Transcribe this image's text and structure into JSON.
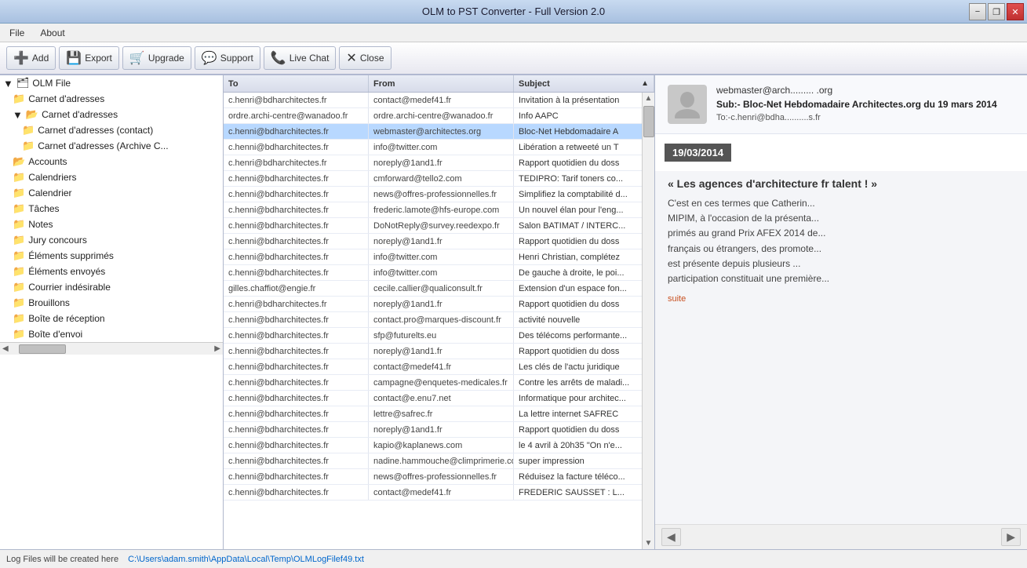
{
  "window": {
    "title": "OLM to PST Converter - Full Version 2.0",
    "controls": {
      "minimize": "−",
      "restore": "❐",
      "close": "✕"
    }
  },
  "menu": {
    "items": [
      "File",
      "About"
    ]
  },
  "toolbar": {
    "buttons": [
      {
        "id": "add",
        "icon": "➕",
        "label": "Add"
      },
      {
        "id": "export",
        "icon": "💾",
        "label": "Export"
      },
      {
        "id": "upgrade",
        "icon": "🛒",
        "label": "Upgrade"
      },
      {
        "id": "support",
        "icon": "💬",
        "label": "Support"
      },
      {
        "id": "livechat",
        "icon": "📞",
        "label": "Live Chat"
      },
      {
        "id": "close",
        "icon": "✕",
        "label": "Close"
      }
    ]
  },
  "tree": {
    "items": [
      {
        "id": "olm-root",
        "indent": 0,
        "icon": "📁",
        "label": "OLM File",
        "expanded": true
      },
      {
        "id": "carnet1",
        "indent": 1,
        "icon": "📂",
        "label": "Carnet d'adresses"
      },
      {
        "id": "carnet2",
        "indent": 1,
        "icon": "📂",
        "label": "Carnet d'adresses",
        "expanded": true
      },
      {
        "id": "carnet-contact",
        "indent": 2,
        "icon": "📂",
        "label": "Carnet d'adresses  (contact)"
      },
      {
        "id": "carnet-archive",
        "indent": 2,
        "icon": "📂",
        "label": "Carnet d'adresses  (Archive C..."
      },
      {
        "id": "accounts",
        "indent": 1,
        "icon": "📂",
        "label": "Accounts"
      },
      {
        "id": "calendriers",
        "indent": 1,
        "icon": "📁",
        "label": "Calendriers"
      },
      {
        "id": "calendrier",
        "indent": 1,
        "icon": "📁",
        "label": "Calendrier"
      },
      {
        "id": "taches",
        "indent": 1,
        "icon": "📁",
        "label": "Tâches"
      },
      {
        "id": "notes",
        "indent": 1,
        "icon": "📁",
        "label": "Notes"
      },
      {
        "id": "jury",
        "indent": 1,
        "icon": "📁",
        "label": "Jury concours"
      },
      {
        "id": "elements-sup",
        "indent": 1,
        "icon": "📁",
        "label": "Éléments supprimés"
      },
      {
        "id": "elements-env",
        "indent": 1,
        "icon": "📁",
        "label": "Éléments envoyés"
      },
      {
        "id": "courrier",
        "indent": 1,
        "icon": "📁",
        "label": "Courrier indésirable"
      },
      {
        "id": "brouillons",
        "indent": 1,
        "icon": "📁",
        "label": "Brouillons"
      },
      {
        "id": "boite-reception",
        "indent": 1,
        "icon": "📁",
        "label": "Boîte de réception"
      },
      {
        "id": "boite-envoi",
        "indent": 1,
        "icon": "📁",
        "label": "Boîte d'envoi"
      }
    ]
  },
  "email_list": {
    "headers": {
      "to": "To",
      "from": "From",
      "subject": "Subject"
    },
    "rows": [
      {
        "to": "c.henri@bdharchitectes.fr",
        "from": "contact@medef41.fr",
        "subject": "Invitation à la présentation"
      },
      {
        "to": "ordre.archi-centre@wanadoo.fr",
        "from": "ordre.archi-centre@wanadoo.fr",
        "subject": "Info AAPC"
      },
      {
        "to": "c.henni@bdharchitectes.fr",
        "from": "webmaster@architectes.org",
        "subject": "Bloc-Net Hebdomadaire A"
      },
      {
        "to": "c.henni@bdharchitectes.fr",
        "from": "info@twitter.com",
        "subject": "Libération a retweeté un T"
      },
      {
        "to": "c.henri@bdharchitectes.fr",
        "from": "noreply@1and1.fr",
        "subject": "Rapport quotidien du doss"
      },
      {
        "to": "c.henni@bdharchitectes.fr",
        "from": "cmforward@tello2.com",
        "subject": "TEDIPRO: Tarif toners co..."
      },
      {
        "to": "c.henni@bdharchitectes.fr",
        "from": "news@offres-professionnelles.fr",
        "subject": "Simplifiez la comptabilité d..."
      },
      {
        "to": "c.henni@bdharchitectes.fr",
        "from": "frederic.lamote@hfs-europe.com",
        "subject": "Un nouvel élan pour l'eng..."
      },
      {
        "to": "c.henni@bdharchitectes.fr",
        "from": "DoNotReply@survey.reedexpo.fr",
        "subject": "Salon BATIMAT / INTERC..."
      },
      {
        "to": "c.henni@bdharchitectes.fr",
        "from": "noreply@1and1.fr",
        "subject": "Rapport quotidien du doss"
      },
      {
        "to": "c.henni@bdharchitectes.fr",
        "from": "info@twitter.com",
        "subject": "Henri Christian, complétez"
      },
      {
        "to": "c.henni@bdharchitectes.fr",
        "from": "info@twitter.com",
        "subject": "De gauche à droite, le poi..."
      },
      {
        "to": "gilles.chaffiot@engie.fr",
        "from": "cecile.callier@qualiconsult.fr",
        "subject": "Extension d'un espace fon..."
      },
      {
        "to": "c.henri@bdharchitectes.fr",
        "from": "noreply@1and1.fr",
        "subject": "Rapport quotidien du doss"
      },
      {
        "to": "c.henni@bdharchitectes.fr",
        "from": "contact.pro@marques-discount.fr",
        "subject": "activité nouvelle"
      },
      {
        "to": "c.henni@bdharchitectes.fr",
        "from": "sfp@futurelts.eu",
        "subject": "Des télécoms performante..."
      },
      {
        "to": "c.henni@bdharchitectes.fr",
        "from": "noreply@1and1.fr",
        "subject": "Rapport quotidien du doss"
      },
      {
        "to": "c.henni@bdharchitectes.fr",
        "from": "contact@medef41.fr",
        "subject": "Les clés de l'actu juridique"
      },
      {
        "to": "c.henni@bdharchitectes.fr",
        "from": "campagne@enquetes-medicales.fr",
        "subject": "Contre les arrêts de maladi..."
      },
      {
        "to": "c.henni@bdharchitectes.fr",
        "from": "contact@e.enu7.net",
        "subject": "Informatique pour architec..."
      },
      {
        "to": "c.henni@bdharchitectes.fr",
        "from": "lettre@safrec.fr",
        "subject": "La lettre internet SAFREC"
      },
      {
        "to": "c.henni@bdharchitectes.fr",
        "from": "noreply@1and1.fr",
        "subject": "Rapport quotidien du doss"
      },
      {
        "to": "c.henni@bdharchitectes.fr",
        "from": "kapio@kaplanews.com",
        "subject": "le 4 avril à 20h35  \"On n'e..."
      },
      {
        "to": "c.henni@bdharchitectes.fr",
        "from": "nadine.hammouche@climprimerie.co",
        "subject": "super  impression"
      },
      {
        "to": "c.henni@bdharchitectes.fr",
        "from": "news@offres-professionnelles.fr",
        "subject": "Réduisez la facture téléco..."
      },
      {
        "to": "c.henni@bdharchitectes.fr",
        "from": "contact@medef41.fr",
        "subject": "FREDERIC SAUSSET : L..."
      }
    ]
  },
  "preview": {
    "from_email": "webmaster@arch......... .org",
    "subject": "Sub:- Bloc-Net Hebdomadaire Architectes.org du 19 mars 2014",
    "to": "To:-c.henri@bdha..........s.fr",
    "date_badge": "19/03/2014",
    "article_title": "« Les agences d'architecture fr talent ! »",
    "article_body": "C'est en ces termes que Catherin... MIPIM, à l'occasion de la présenta... primés au grand Prix AFEX 2014 de... français ou étrangers, des promote... est présente depuis plusieurs ... participation constituait une première...",
    "article_link": "suite"
  },
  "status": {
    "log_label": "Log Files will be created here",
    "log_path": "C:\\Users\\adam.smith\\AppData\\Local\\Temp\\OLMLogFilef49.txt"
  }
}
